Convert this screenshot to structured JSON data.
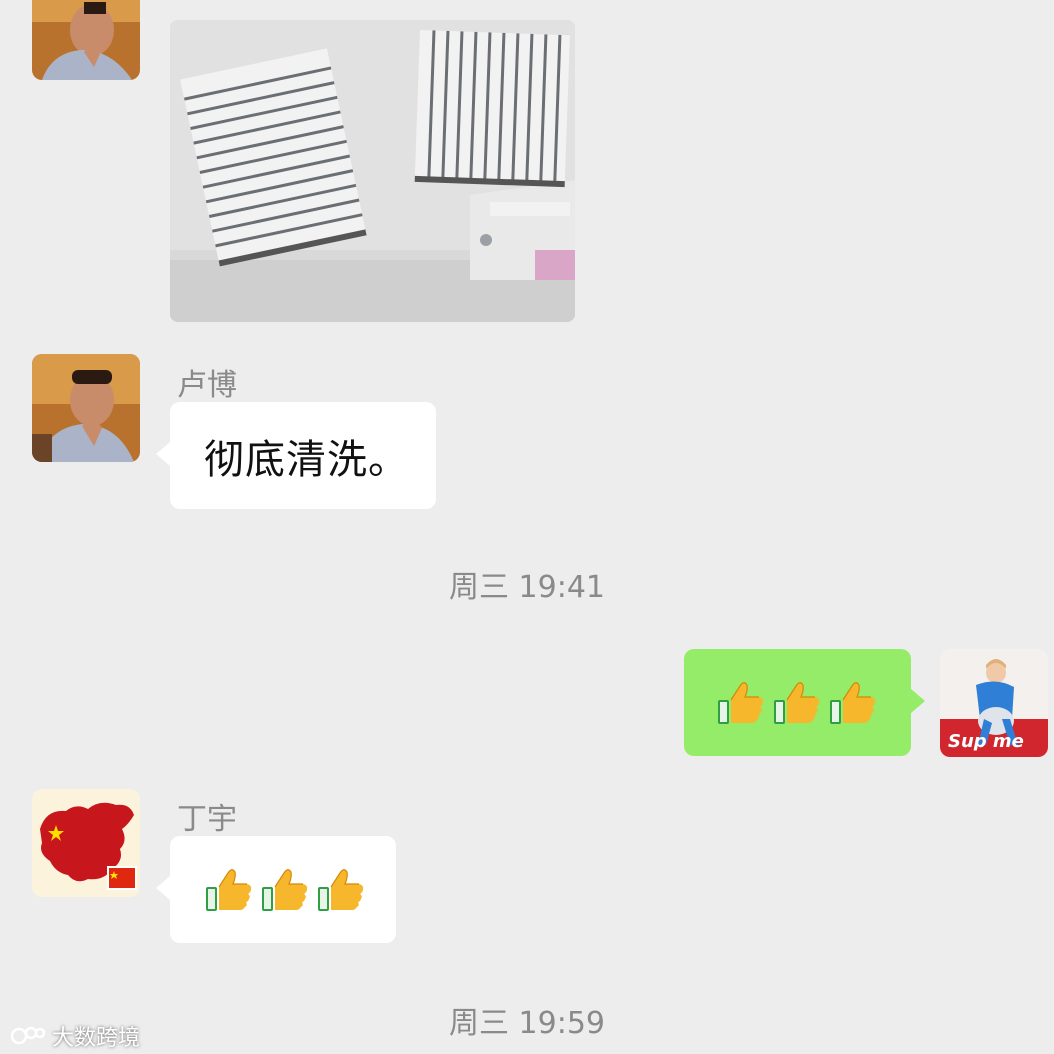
{
  "messages": {
    "m1": {
      "sender": "卢博",
      "type": "image"
    },
    "m2": {
      "sender": "卢博",
      "text": "彻底清洗。"
    },
    "ts1": "周三 19:41",
    "m3": {
      "sender": "me",
      "emoji": "thumbs-up x3"
    },
    "m4": {
      "sender": "丁宇",
      "emoji": "thumbs-up x3"
    },
    "ts2": "周三 19:59"
  },
  "watermark": {
    "text": "大数跨境"
  },
  "colors": {
    "background": "#ededed",
    "incoming_bubble": "#ffffff",
    "outgoing_bubble": "#95ec69",
    "sender_name": "#8a8a8a",
    "timestamp": "#8a8a8a"
  },
  "icons": [
    "avatar-man-photo",
    "avatar-china-map-flag",
    "avatar-girl-supreme",
    "thumbs-up-icon",
    "watermark-logo-icon"
  ]
}
